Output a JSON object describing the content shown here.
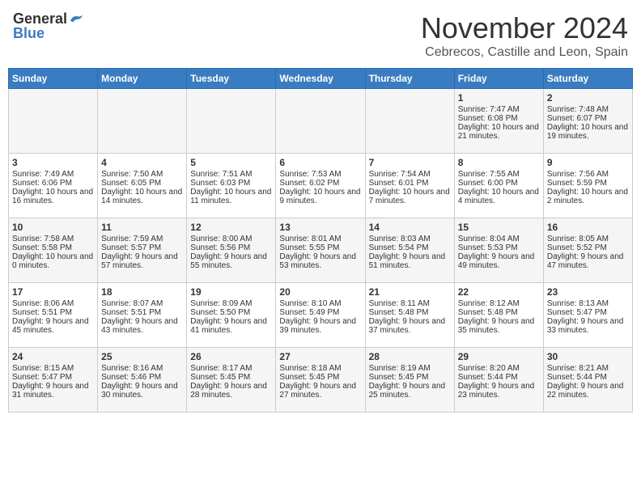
{
  "header": {
    "logo_general": "General",
    "logo_blue": "Blue",
    "month": "November 2024",
    "location": "Cebrecos, Castille and Leon, Spain"
  },
  "days_of_week": [
    "Sunday",
    "Monday",
    "Tuesday",
    "Wednesday",
    "Thursday",
    "Friday",
    "Saturday"
  ],
  "weeks": [
    [
      {
        "day": "",
        "info": ""
      },
      {
        "day": "",
        "info": ""
      },
      {
        "day": "",
        "info": ""
      },
      {
        "day": "",
        "info": ""
      },
      {
        "day": "",
        "info": ""
      },
      {
        "day": "1",
        "info": "Sunrise: 7:47 AM\nSunset: 6:08 PM\nDaylight: 10 hours and 21 minutes."
      },
      {
        "day": "2",
        "info": "Sunrise: 7:48 AM\nSunset: 6:07 PM\nDaylight: 10 hours and 19 minutes."
      }
    ],
    [
      {
        "day": "3",
        "info": "Sunrise: 7:49 AM\nSunset: 6:06 PM\nDaylight: 10 hours and 16 minutes."
      },
      {
        "day": "4",
        "info": "Sunrise: 7:50 AM\nSunset: 6:05 PM\nDaylight: 10 hours and 14 minutes."
      },
      {
        "day": "5",
        "info": "Sunrise: 7:51 AM\nSunset: 6:03 PM\nDaylight: 10 hours and 11 minutes."
      },
      {
        "day": "6",
        "info": "Sunrise: 7:53 AM\nSunset: 6:02 PM\nDaylight: 10 hours and 9 minutes."
      },
      {
        "day": "7",
        "info": "Sunrise: 7:54 AM\nSunset: 6:01 PM\nDaylight: 10 hours and 7 minutes."
      },
      {
        "day": "8",
        "info": "Sunrise: 7:55 AM\nSunset: 6:00 PM\nDaylight: 10 hours and 4 minutes."
      },
      {
        "day": "9",
        "info": "Sunrise: 7:56 AM\nSunset: 5:59 PM\nDaylight: 10 hours and 2 minutes."
      }
    ],
    [
      {
        "day": "10",
        "info": "Sunrise: 7:58 AM\nSunset: 5:58 PM\nDaylight: 10 hours and 0 minutes."
      },
      {
        "day": "11",
        "info": "Sunrise: 7:59 AM\nSunset: 5:57 PM\nDaylight: 9 hours and 57 minutes."
      },
      {
        "day": "12",
        "info": "Sunrise: 8:00 AM\nSunset: 5:56 PM\nDaylight: 9 hours and 55 minutes."
      },
      {
        "day": "13",
        "info": "Sunrise: 8:01 AM\nSunset: 5:55 PM\nDaylight: 9 hours and 53 minutes."
      },
      {
        "day": "14",
        "info": "Sunrise: 8:03 AM\nSunset: 5:54 PM\nDaylight: 9 hours and 51 minutes."
      },
      {
        "day": "15",
        "info": "Sunrise: 8:04 AM\nSunset: 5:53 PM\nDaylight: 9 hours and 49 minutes."
      },
      {
        "day": "16",
        "info": "Sunrise: 8:05 AM\nSunset: 5:52 PM\nDaylight: 9 hours and 47 minutes."
      }
    ],
    [
      {
        "day": "17",
        "info": "Sunrise: 8:06 AM\nSunset: 5:51 PM\nDaylight: 9 hours and 45 minutes."
      },
      {
        "day": "18",
        "info": "Sunrise: 8:07 AM\nSunset: 5:51 PM\nDaylight: 9 hours and 43 minutes."
      },
      {
        "day": "19",
        "info": "Sunrise: 8:09 AM\nSunset: 5:50 PM\nDaylight: 9 hours and 41 minutes."
      },
      {
        "day": "20",
        "info": "Sunrise: 8:10 AM\nSunset: 5:49 PM\nDaylight: 9 hours and 39 minutes."
      },
      {
        "day": "21",
        "info": "Sunrise: 8:11 AM\nSunset: 5:48 PM\nDaylight: 9 hours and 37 minutes."
      },
      {
        "day": "22",
        "info": "Sunrise: 8:12 AM\nSunset: 5:48 PM\nDaylight: 9 hours and 35 minutes."
      },
      {
        "day": "23",
        "info": "Sunrise: 8:13 AM\nSunset: 5:47 PM\nDaylight: 9 hours and 33 minutes."
      }
    ],
    [
      {
        "day": "24",
        "info": "Sunrise: 8:15 AM\nSunset: 5:47 PM\nDaylight: 9 hours and 31 minutes."
      },
      {
        "day": "25",
        "info": "Sunrise: 8:16 AM\nSunset: 5:46 PM\nDaylight: 9 hours and 30 minutes."
      },
      {
        "day": "26",
        "info": "Sunrise: 8:17 AM\nSunset: 5:45 PM\nDaylight: 9 hours and 28 minutes."
      },
      {
        "day": "27",
        "info": "Sunrise: 8:18 AM\nSunset: 5:45 PM\nDaylight: 9 hours and 27 minutes."
      },
      {
        "day": "28",
        "info": "Sunrise: 8:19 AM\nSunset: 5:45 PM\nDaylight: 9 hours and 25 minutes."
      },
      {
        "day": "29",
        "info": "Sunrise: 8:20 AM\nSunset: 5:44 PM\nDaylight: 9 hours and 23 minutes."
      },
      {
        "day": "30",
        "info": "Sunrise: 8:21 AM\nSunset: 5:44 PM\nDaylight: 9 hours and 22 minutes."
      }
    ]
  ]
}
